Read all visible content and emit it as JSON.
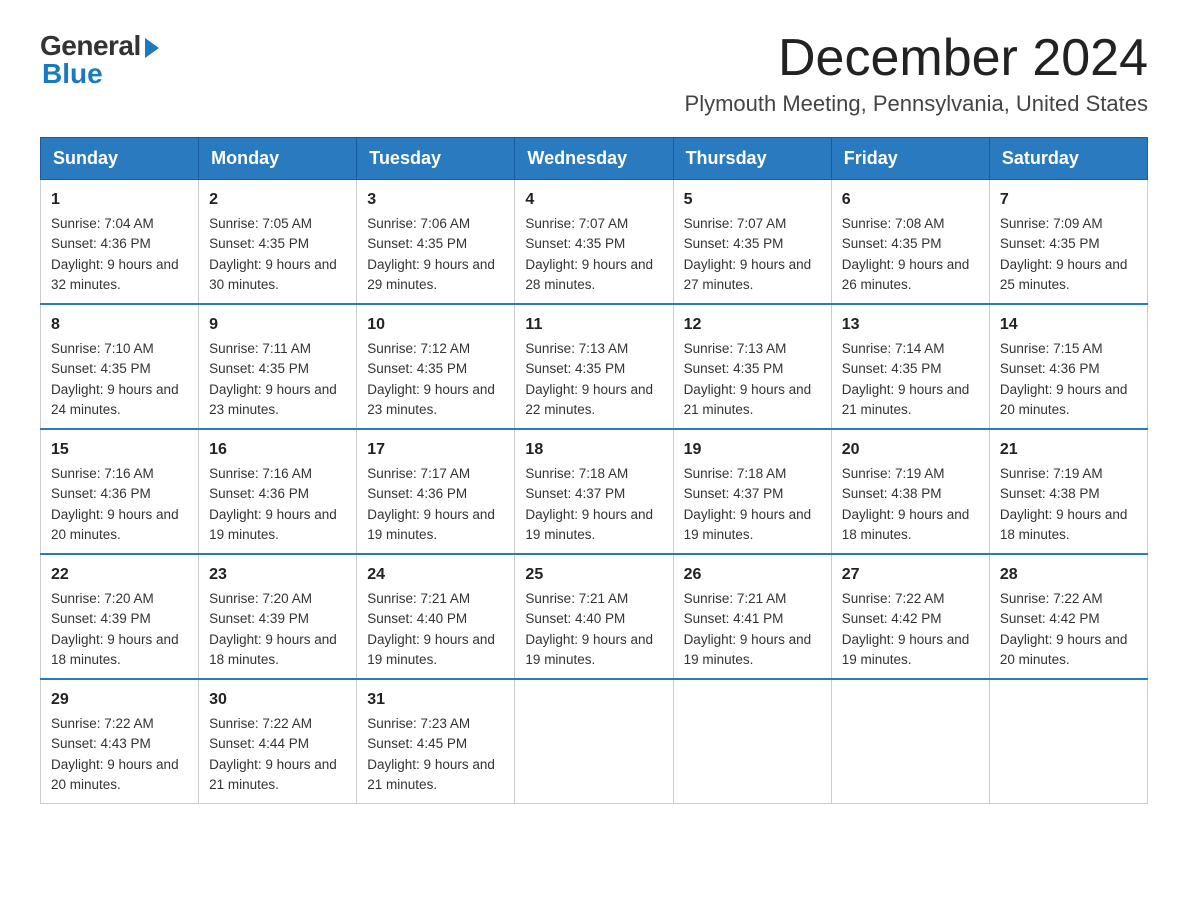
{
  "header": {
    "logo_general": "General",
    "logo_blue": "Blue",
    "month_title": "December 2024",
    "location": "Plymouth Meeting, Pennsylvania, United States"
  },
  "weekdays": [
    "Sunday",
    "Monday",
    "Tuesday",
    "Wednesday",
    "Thursday",
    "Friday",
    "Saturday"
  ],
  "weeks": [
    [
      {
        "day": "1",
        "sunrise": "Sunrise: 7:04 AM",
        "sunset": "Sunset: 4:36 PM",
        "daylight": "Daylight: 9 hours and 32 minutes."
      },
      {
        "day": "2",
        "sunrise": "Sunrise: 7:05 AM",
        "sunset": "Sunset: 4:35 PM",
        "daylight": "Daylight: 9 hours and 30 minutes."
      },
      {
        "day": "3",
        "sunrise": "Sunrise: 7:06 AM",
        "sunset": "Sunset: 4:35 PM",
        "daylight": "Daylight: 9 hours and 29 minutes."
      },
      {
        "day": "4",
        "sunrise": "Sunrise: 7:07 AM",
        "sunset": "Sunset: 4:35 PM",
        "daylight": "Daylight: 9 hours and 28 minutes."
      },
      {
        "day": "5",
        "sunrise": "Sunrise: 7:07 AM",
        "sunset": "Sunset: 4:35 PM",
        "daylight": "Daylight: 9 hours and 27 minutes."
      },
      {
        "day": "6",
        "sunrise": "Sunrise: 7:08 AM",
        "sunset": "Sunset: 4:35 PM",
        "daylight": "Daylight: 9 hours and 26 minutes."
      },
      {
        "day": "7",
        "sunrise": "Sunrise: 7:09 AM",
        "sunset": "Sunset: 4:35 PM",
        "daylight": "Daylight: 9 hours and 25 minutes."
      }
    ],
    [
      {
        "day": "8",
        "sunrise": "Sunrise: 7:10 AM",
        "sunset": "Sunset: 4:35 PM",
        "daylight": "Daylight: 9 hours and 24 minutes."
      },
      {
        "day": "9",
        "sunrise": "Sunrise: 7:11 AM",
        "sunset": "Sunset: 4:35 PM",
        "daylight": "Daylight: 9 hours and 23 minutes."
      },
      {
        "day": "10",
        "sunrise": "Sunrise: 7:12 AM",
        "sunset": "Sunset: 4:35 PM",
        "daylight": "Daylight: 9 hours and 23 minutes."
      },
      {
        "day": "11",
        "sunrise": "Sunrise: 7:13 AM",
        "sunset": "Sunset: 4:35 PM",
        "daylight": "Daylight: 9 hours and 22 minutes."
      },
      {
        "day": "12",
        "sunrise": "Sunrise: 7:13 AM",
        "sunset": "Sunset: 4:35 PM",
        "daylight": "Daylight: 9 hours and 21 minutes."
      },
      {
        "day": "13",
        "sunrise": "Sunrise: 7:14 AM",
        "sunset": "Sunset: 4:35 PM",
        "daylight": "Daylight: 9 hours and 21 minutes."
      },
      {
        "day": "14",
        "sunrise": "Sunrise: 7:15 AM",
        "sunset": "Sunset: 4:36 PM",
        "daylight": "Daylight: 9 hours and 20 minutes."
      }
    ],
    [
      {
        "day": "15",
        "sunrise": "Sunrise: 7:16 AM",
        "sunset": "Sunset: 4:36 PM",
        "daylight": "Daylight: 9 hours and 20 minutes."
      },
      {
        "day": "16",
        "sunrise": "Sunrise: 7:16 AM",
        "sunset": "Sunset: 4:36 PM",
        "daylight": "Daylight: 9 hours and 19 minutes."
      },
      {
        "day": "17",
        "sunrise": "Sunrise: 7:17 AM",
        "sunset": "Sunset: 4:36 PM",
        "daylight": "Daylight: 9 hours and 19 minutes."
      },
      {
        "day": "18",
        "sunrise": "Sunrise: 7:18 AM",
        "sunset": "Sunset: 4:37 PM",
        "daylight": "Daylight: 9 hours and 19 minutes."
      },
      {
        "day": "19",
        "sunrise": "Sunrise: 7:18 AM",
        "sunset": "Sunset: 4:37 PM",
        "daylight": "Daylight: 9 hours and 19 minutes."
      },
      {
        "day": "20",
        "sunrise": "Sunrise: 7:19 AM",
        "sunset": "Sunset: 4:38 PM",
        "daylight": "Daylight: 9 hours and 18 minutes."
      },
      {
        "day": "21",
        "sunrise": "Sunrise: 7:19 AM",
        "sunset": "Sunset: 4:38 PM",
        "daylight": "Daylight: 9 hours and 18 minutes."
      }
    ],
    [
      {
        "day": "22",
        "sunrise": "Sunrise: 7:20 AM",
        "sunset": "Sunset: 4:39 PM",
        "daylight": "Daylight: 9 hours and 18 minutes."
      },
      {
        "day": "23",
        "sunrise": "Sunrise: 7:20 AM",
        "sunset": "Sunset: 4:39 PM",
        "daylight": "Daylight: 9 hours and 18 minutes."
      },
      {
        "day": "24",
        "sunrise": "Sunrise: 7:21 AM",
        "sunset": "Sunset: 4:40 PM",
        "daylight": "Daylight: 9 hours and 19 minutes."
      },
      {
        "day": "25",
        "sunrise": "Sunrise: 7:21 AM",
        "sunset": "Sunset: 4:40 PM",
        "daylight": "Daylight: 9 hours and 19 minutes."
      },
      {
        "day": "26",
        "sunrise": "Sunrise: 7:21 AM",
        "sunset": "Sunset: 4:41 PM",
        "daylight": "Daylight: 9 hours and 19 minutes."
      },
      {
        "day": "27",
        "sunrise": "Sunrise: 7:22 AM",
        "sunset": "Sunset: 4:42 PM",
        "daylight": "Daylight: 9 hours and 19 minutes."
      },
      {
        "day": "28",
        "sunrise": "Sunrise: 7:22 AM",
        "sunset": "Sunset: 4:42 PM",
        "daylight": "Daylight: 9 hours and 20 minutes."
      }
    ],
    [
      {
        "day": "29",
        "sunrise": "Sunrise: 7:22 AM",
        "sunset": "Sunset: 4:43 PM",
        "daylight": "Daylight: 9 hours and 20 minutes."
      },
      {
        "day": "30",
        "sunrise": "Sunrise: 7:22 AM",
        "sunset": "Sunset: 4:44 PM",
        "daylight": "Daylight: 9 hours and 21 minutes."
      },
      {
        "day": "31",
        "sunrise": "Sunrise: 7:23 AM",
        "sunset": "Sunset: 4:45 PM",
        "daylight": "Daylight: 9 hours and 21 minutes."
      },
      null,
      null,
      null,
      null
    ]
  ]
}
